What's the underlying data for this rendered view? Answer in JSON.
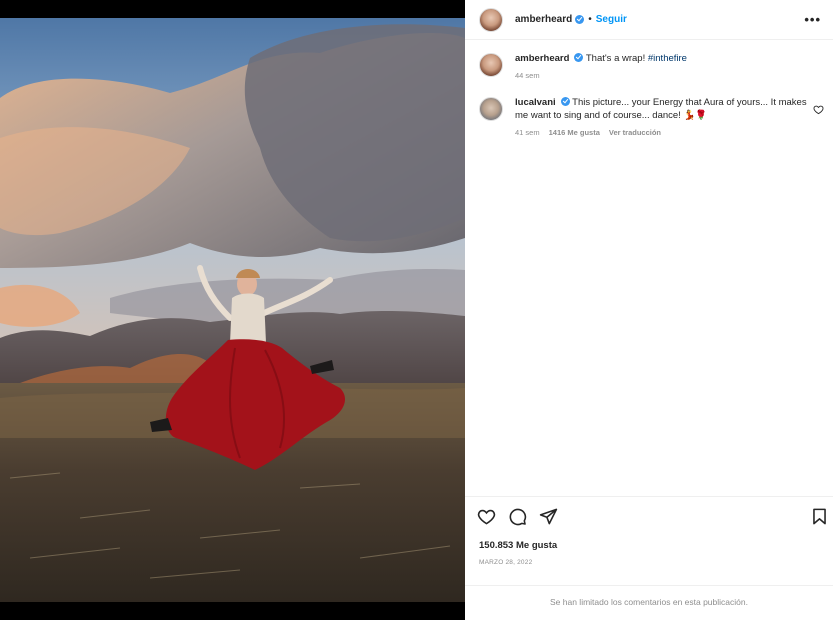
{
  "post": {
    "author": "amberheard",
    "follow_label": "Seguir",
    "dot": "•",
    "more_icon": "more-options-icon",
    "photo_description_icon": "post-photo"
  },
  "comments": [
    {
      "username": "amberheard",
      "text": "That's a wrap!",
      "hashtag": "#inthefire",
      "time": "44 sem"
    },
    {
      "username": "lucalvani",
      "text": "This picture... your Energy that Aura of yours... It makes me want to sing and of course... dance! 💃🌹",
      "time": "41 sem",
      "likes": "1416 Me gusta",
      "translate": "Ver traducción"
    }
  ],
  "actions": {
    "likes": "150.853 Me gusta",
    "date": "MARZO 28, 2022",
    "comments_limited": "Se han limitado los comentarios en esta publicación."
  },
  "colors": {
    "accent": "#0095f6",
    "verified": "#3897f0",
    "hashtag": "#00376b",
    "muted": "#8e8e8e"
  }
}
